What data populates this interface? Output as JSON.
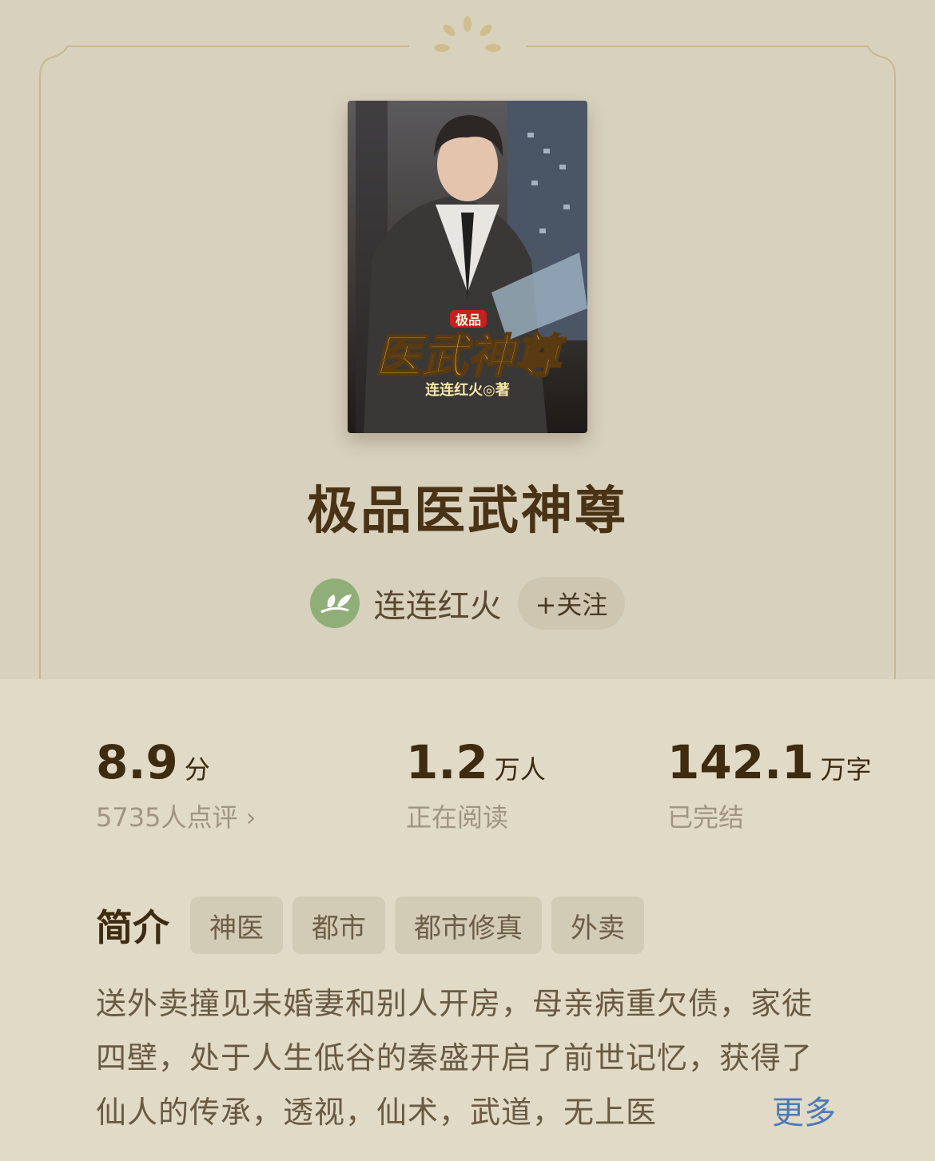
{
  "book": {
    "cover_small_title": "极品",
    "cover_title": "医武神尊",
    "cover_author": "连连红火◎著",
    "title": "极品医武神尊"
  },
  "author": {
    "name": "连连红火",
    "follow_label": "+关注"
  },
  "stats": [
    {
      "value": "8.9",
      "unit": "分",
      "sub": "5735人点评 ›"
    },
    {
      "value": "1.2",
      "unit": "万人",
      "sub": "正在阅读"
    },
    {
      "value": "142.1",
      "unit": "万字",
      "sub": "已完结"
    }
  ],
  "intro": {
    "label": "简介",
    "tags": [
      "神医",
      "都市",
      "都市修真",
      "外卖"
    ],
    "text": "送外卖撞见未婚妻和别人开房，母亲病重欠债，家徒四壁，处于人生低谷的秦盛开启了前世记忆，获得了仙人的传承，透视，仙术，武道，无上医",
    "more_label": "更多"
  },
  "colors": {
    "title": "#4a3315",
    "link": "#4c7ab8",
    "background": "#d9d3c0"
  }
}
